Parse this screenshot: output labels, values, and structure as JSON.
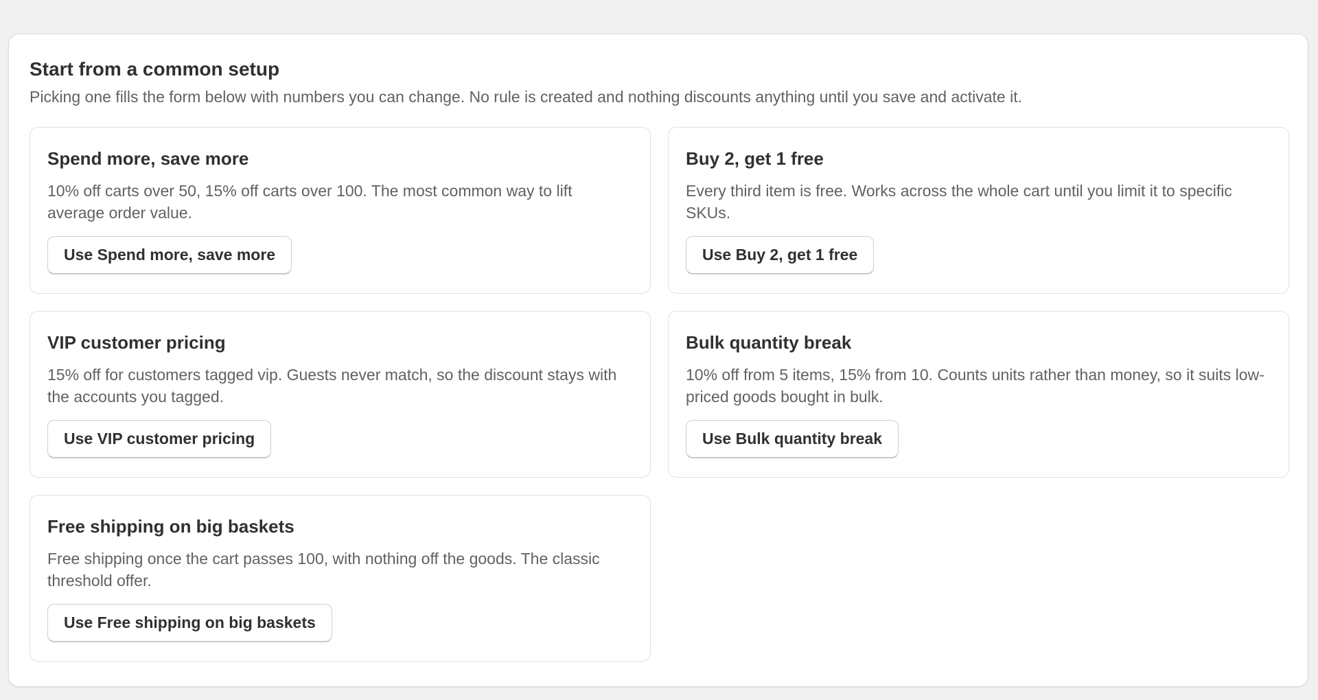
{
  "section": {
    "title": "Start from a common setup",
    "description": "Picking one fills the form below with numbers you can change. No rule is created and nothing discounts anything until you save and activate it."
  },
  "presets": [
    {
      "title": "Spend more, save more",
      "description": "10% off carts over 50, 15% off carts over 100. The most common way to lift average order value.",
      "button": "Use Spend more, save more"
    },
    {
      "title": "Buy 2, get 1 free",
      "description": "Every third item is free. Works across the whole cart until you limit it to specific SKUs.",
      "button": "Use Buy 2, get 1 free"
    },
    {
      "title": "VIP customer pricing",
      "description": "15% off for customers tagged vip. Guests never match, so the discount stays with the accounts you tagged.",
      "button": "Use VIP customer pricing"
    },
    {
      "title": "Bulk quantity break",
      "description": "10% off from 5 items, 15% from 10. Counts units rather than money, so it suits low-priced goods bought in bulk.",
      "button": "Use Bulk quantity break"
    },
    {
      "title": "Free shipping on big baskets",
      "description": "Free shipping once the cart passes 100, with nothing off the goods. The classic threshold offer.",
      "button": "Use Free shipping on big baskets"
    }
  ]
}
